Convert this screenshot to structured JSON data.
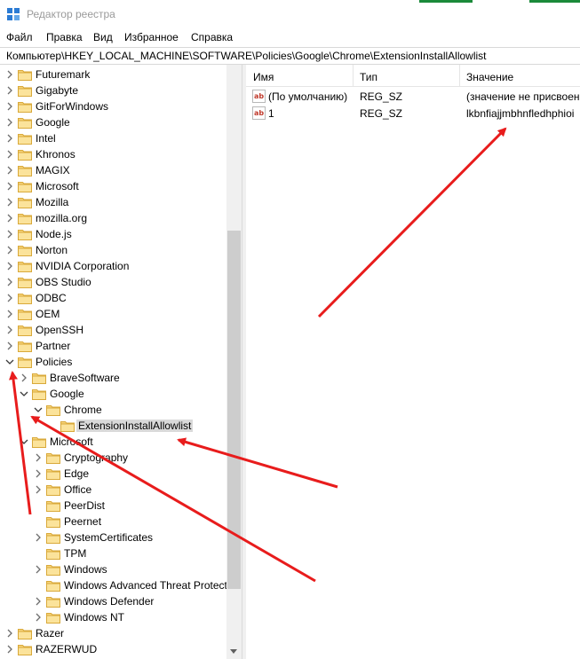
{
  "window": {
    "title": "Редактор реестра"
  },
  "menu": [
    "Файл",
    "Правка",
    "Вид",
    "Избранное",
    "Справка"
  ],
  "address": "Компьютер\\HKEY_LOCAL_MACHINE\\SOFTWARE\\Policies\\Google\\Chrome\\ExtensionInstallAllowlist",
  "tree": [
    {
      "label": "Futuremark",
      "state": "collapsed",
      "level": 0
    },
    {
      "label": "Gigabyte",
      "state": "collapsed",
      "level": 0
    },
    {
      "label": "GitForWindows",
      "state": "collapsed",
      "level": 0
    },
    {
      "label": "Google",
      "state": "collapsed",
      "level": 0
    },
    {
      "label": "Intel",
      "state": "collapsed",
      "level": 0
    },
    {
      "label": "Khronos",
      "state": "collapsed",
      "level": 0
    },
    {
      "label": "MAGIX",
      "state": "collapsed",
      "level": 0
    },
    {
      "label": "Microsoft",
      "state": "collapsed",
      "level": 0
    },
    {
      "label": "Mozilla",
      "state": "collapsed",
      "level": 0
    },
    {
      "label": "mozilla.org",
      "state": "collapsed",
      "level": 0
    },
    {
      "label": "Node.js",
      "state": "collapsed",
      "level": 0
    },
    {
      "label": "Norton",
      "state": "collapsed",
      "level": 0
    },
    {
      "label": "NVIDIA Corporation",
      "state": "collapsed",
      "level": 0
    },
    {
      "label": "OBS Studio",
      "state": "collapsed",
      "level": 0
    },
    {
      "label": "ODBC",
      "state": "collapsed",
      "level": 0
    },
    {
      "label": "OEM",
      "state": "collapsed",
      "level": 0
    },
    {
      "label": "OpenSSH",
      "state": "collapsed",
      "level": 0
    },
    {
      "label": "Partner",
      "state": "collapsed",
      "level": 0
    },
    {
      "label": "Policies",
      "state": "expanded",
      "level": 0
    },
    {
      "label": "BraveSoftware",
      "state": "collapsed",
      "level": 1
    },
    {
      "label": "Google",
      "state": "expanded",
      "level": 1
    },
    {
      "label": "Chrome",
      "state": "expanded",
      "level": 2
    },
    {
      "label": "ExtensionInstallAllowlist",
      "state": "leaf",
      "level": 3,
      "selected": true
    },
    {
      "label": "Microsoft",
      "state": "expanded",
      "level": 1
    },
    {
      "label": "Cryptography",
      "state": "collapsed",
      "level": 2
    },
    {
      "label": "Edge",
      "state": "collapsed",
      "level": 2
    },
    {
      "label": "Office",
      "state": "collapsed",
      "level": 2
    },
    {
      "label": "PeerDist",
      "state": "leaf",
      "level": 2
    },
    {
      "label": "Peernet",
      "state": "leaf",
      "level": 2
    },
    {
      "label": "SystemCertificates",
      "state": "collapsed",
      "level": 2
    },
    {
      "label": "TPM",
      "state": "leaf",
      "level": 2
    },
    {
      "label": "Windows",
      "state": "collapsed",
      "level": 2
    },
    {
      "label": "Windows Advanced Threat Protecti",
      "state": "leaf",
      "level": 2
    },
    {
      "label": "Windows Defender",
      "state": "collapsed",
      "level": 2
    },
    {
      "label": "Windows NT",
      "state": "collapsed",
      "level": 2
    },
    {
      "label": "Razer",
      "state": "collapsed",
      "level": 0
    },
    {
      "label": "RAZERWUD",
      "state": "collapsed",
      "level": 0
    }
  ],
  "columns": {
    "name": "Имя",
    "type": "Тип",
    "value": "Значение"
  },
  "values": [
    {
      "name": "(По умолчанию)",
      "type": "REG_SZ",
      "data": "(значение не присвоен"
    },
    {
      "name": "1",
      "type": "REG_SZ",
      "data": "lkbnfiajjmbhnfledhphioi"
    }
  ],
  "colors": {
    "annotation_arrow": "#e81c1c",
    "folder": "#f6d47a",
    "selection": "#d9d9d9"
  }
}
